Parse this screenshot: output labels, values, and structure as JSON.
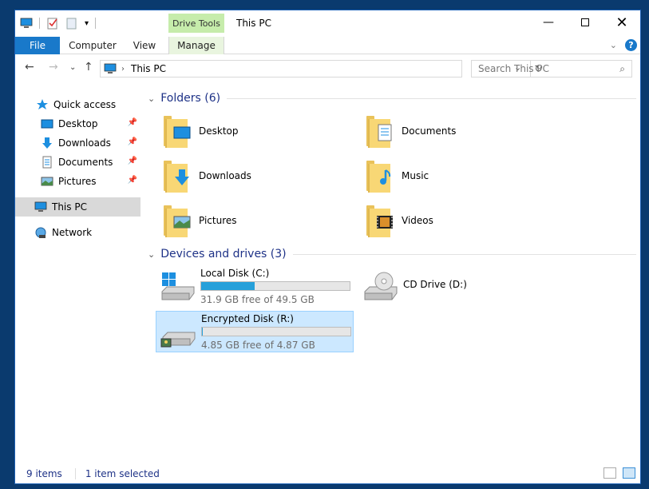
{
  "window": {
    "title": "This PC"
  },
  "ribbon": {
    "context_group": "Drive Tools",
    "tabs": [
      "File",
      "Computer",
      "View",
      "Manage"
    ]
  },
  "address": {
    "path": "This PC"
  },
  "search": {
    "placeholder": "Search This PC"
  },
  "nav": {
    "items": [
      {
        "label": "Quick access",
        "icon": "star-icon"
      },
      {
        "label": "Desktop",
        "icon": "desktop-icon",
        "pinned": true
      },
      {
        "label": "Downloads",
        "icon": "download-arrow-icon",
        "pinned": true
      },
      {
        "label": "Documents",
        "icon": "documents-icon",
        "pinned": true
      },
      {
        "label": "Pictures",
        "icon": "pictures-icon",
        "pinned": true
      },
      {
        "label": "This PC",
        "icon": "computer-icon",
        "selected": true
      },
      {
        "label": "Network",
        "icon": "network-icon"
      }
    ]
  },
  "folders": {
    "header": "Folders (6)",
    "items": [
      {
        "label": "Desktop",
        "icon": "desktop-folder-icon"
      },
      {
        "label": "Documents",
        "icon": "documents-folder-icon"
      },
      {
        "label": "Downloads",
        "icon": "downloads-folder-icon"
      },
      {
        "label": "Music",
        "icon": "music-folder-icon"
      },
      {
        "label": "Pictures",
        "icon": "pictures-folder-icon"
      },
      {
        "label": "Videos",
        "icon": "videos-folder-icon"
      }
    ]
  },
  "drives": {
    "header": "Devices and drives (3)",
    "items": [
      {
        "name": "Local Disk (C:)",
        "free_text": "31.9 GB free of 49.5 GB",
        "used_fraction": 0.36,
        "icon": "windows-drive-icon"
      },
      {
        "name": "CD Drive (D:)",
        "icon": "cd-drive-icon"
      },
      {
        "name": "Encrypted Disk (R:)",
        "free_text": "4.85 GB free of 4.87 GB",
        "used_fraction": 0.004,
        "icon": "encrypted-drive-icon",
        "selected": true
      }
    ]
  },
  "status": {
    "items": "9 items",
    "selected": "1 item selected"
  },
  "colors": {
    "accent": "#1979ca",
    "selection": "#cce8ff",
    "context_tab": "#c6ecab",
    "bar_fill": "#26a0da"
  }
}
